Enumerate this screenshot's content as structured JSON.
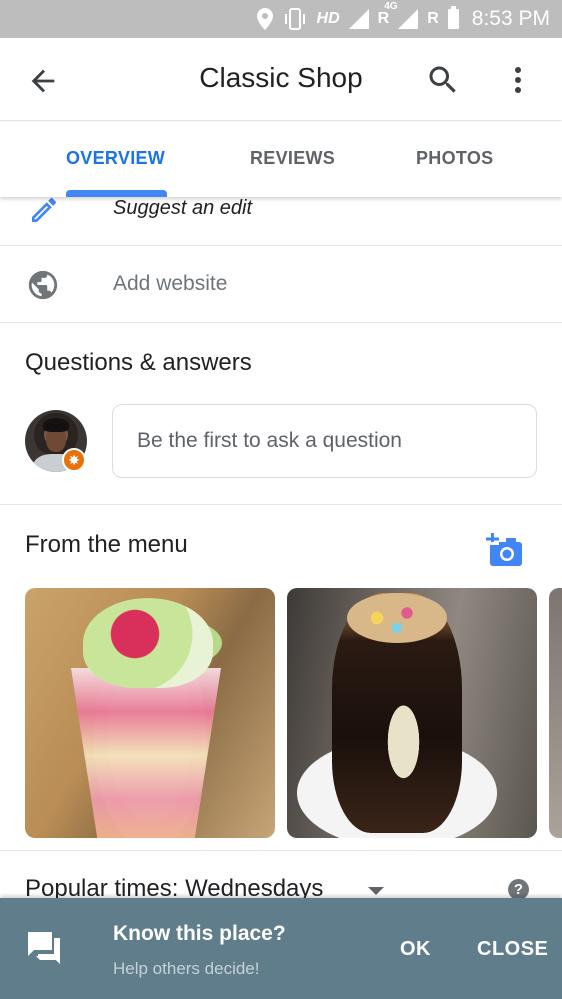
{
  "status_bar": {
    "icons": [
      "location-icon",
      "vibrate-icon",
      "hd-indicator",
      "signal-icon",
      "roaming-indicator",
      "signal-4g-icon",
      "roaming-indicator",
      "battery-icon"
    ],
    "hd_label": "HD",
    "roaming_label": "R",
    "network_label": "4G",
    "time": "8:53 PM"
  },
  "app_bar": {
    "title": "Classic Shop",
    "back_icon": "arrow-back-icon",
    "search_icon": "search-icon",
    "more_icon": "more-vert-icon"
  },
  "tabs": [
    {
      "label": "OVERVIEW",
      "active": true
    },
    {
      "label": "REVIEWS",
      "active": false
    },
    {
      "label": "PHOTOS",
      "active": false
    }
  ],
  "rows": {
    "suggest_edit": {
      "label": "Suggest an edit",
      "icon": "pencil-icon"
    },
    "add_website": {
      "label": "Add website",
      "icon": "globe-icon"
    }
  },
  "questions": {
    "heading": "Questions & answers",
    "input_placeholder": "Be the first to ask a question",
    "avatar_badge": "local-guide-badge"
  },
  "menu": {
    "heading": "From the menu",
    "add_photo_icon": "add-photo-icon",
    "photos": [
      {
        "alt": "Ice cream sundae in plastic cup with sprinkles"
      },
      {
        "alt": "Chocolate sundae with cone on white plate"
      },
      {
        "alt": "Partially visible photo"
      }
    ]
  },
  "popular_times": {
    "label": "Popular times:",
    "day": "Wednesdays",
    "help": "?"
  },
  "snackbar": {
    "title": "Know this place?",
    "subtitle": "Help others decide!",
    "ok_label": "OK",
    "close_label": "CLOSE"
  },
  "colors": {
    "accent": "#1a73e8",
    "tab_indicator": "#4285f4",
    "snackbar_bg": "#607d8b",
    "badge_orange": "#e8710a",
    "status_bar": "#bdbdbd"
  }
}
